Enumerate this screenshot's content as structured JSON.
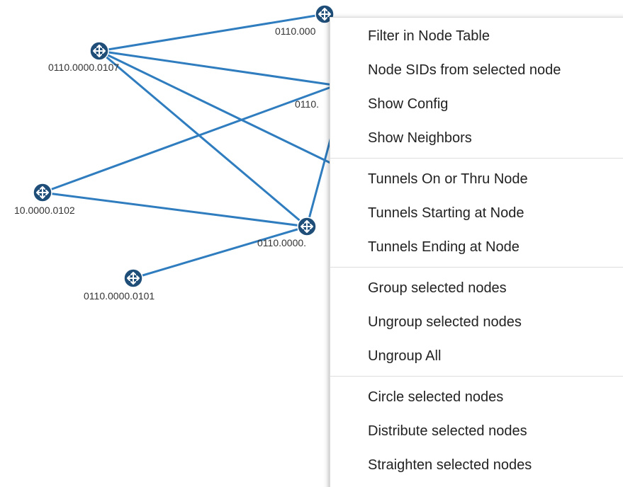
{
  "topology": {
    "link_color": "#2f7dbf",
    "node_color": "#1f4e79",
    "node_icon": "router-icon",
    "nodes": [
      {
        "id": "n0107",
        "label": "0110.0000.0107"
      },
      {
        "id": "n_top",
        "label": "0110.000"
      },
      {
        "id": "n_mid",
        "label": "0110."
      },
      {
        "id": "n0102",
        "label": "10.0000.0102"
      },
      {
        "id": "n_center",
        "label": "0110.0000."
      },
      {
        "id": "n0101",
        "label": "0110.0000.0101"
      }
    ]
  },
  "context_menu": {
    "groups": [
      [
        "Filter in Node Table",
        "Node SIDs from selected node",
        "Show Config",
        "Show Neighbors"
      ],
      [
        "Tunnels On or Thru Node",
        "Tunnels Starting at Node",
        "Tunnels Ending at Node"
      ],
      [
        "Group selected nodes",
        "Ungroup selected nodes",
        "Ungroup All"
      ],
      [
        "Circle selected nodes",
        "Distribute selected nodes",
        "Straighten selected nodes"
      ]
    ]
  }
}
